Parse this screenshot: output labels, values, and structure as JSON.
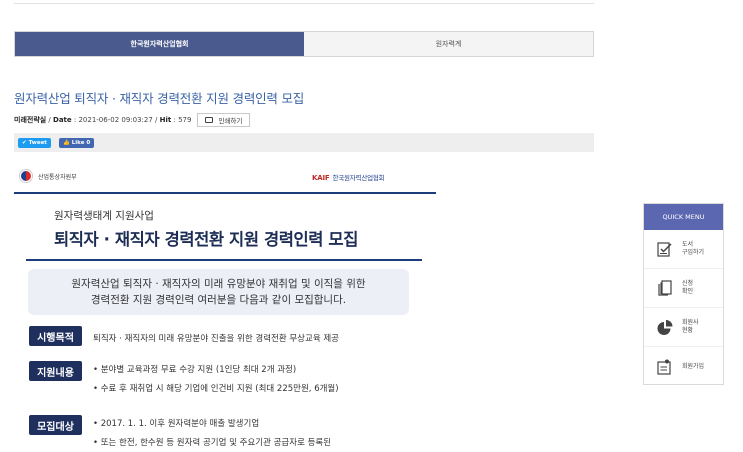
{
  "tabs": [
    {
      "label": "한국원자력산업협회"
    },
    {
      "label": "원자력계"
    }
  ],
  "article": {
    "title": "원자력산업 퇴직자 · 재직자 경력전환 지원 경력인력 모집",
    "author": "미래전략실",
    "date_label": "Date",
    "date": "2021-06-02 09:03:27",
    "hit_label": "Hit",
    "hit": "579",
    "print_label": "인쇄하기"
  },
  "social": {
    "tweet": "Tweet",
    "like": "Like 0"
  },
  "poster": {
    "ministry": "산업통상자원부",
    "kaif_mark": "KAIF",
    "kaif_name": "한국원자력산업협회",
    "subtitle": "원자력생태계 지원사업",
    "headline": "퇴직자 · 재직자 경력전환 지원 경력인력 모집",
    "intro_line1": "원자력산업 퇴직자 · 재직자의 미래 유망분야 재취업 및 이직을 위한",
    "intro_line2": "경력전환 지원 경력인력 여러분을 다음과 같이 모집합니다.",
    "rows": [
      {
        "badge": "시행목적",
        "lines": [
          "퇴직자 · 재직자의 미래 유망분야 진출을 위한 경력전환 무상교육 제공"
        ]
      },
      {
        "badge": "지원내용",
        "lines": [
          "• 분야별 교육과정 무료 수강 지원 (1인당 최대 2개 과정)",
          "• 수료 후 재취업 시 해당 기업에 인건비 지원 (최대 225만원, 6개월)"
        ]
      },
      {
        "badge": "모집대상",
        "lines": [
          "• 2017. 1. 1. 이후 원자력분야 매출 발생기업",
          "• 또는 한전, 한수원 등 원자력 공기업 및 주요기관 공급자로 등록된"
        ]
      }
    ]
  },
  "quick_menu": {
    "title": "QUICK MENU",
    "items": [
      {
        "label_1": "도서",
        "label_2": "구입하기",
        "icon": "book-check-icon"
      },
      {
        "label_1": "신청",
        "label_2": "확인",
        "icon": "document-stack-icon"
      },
      {
        "label_1": "회원사",
        "label_2": "현황",
        "icon": "pie-chart-icon"
      },
      {
        "label_1": "회원가입",
        "label_2": "",
        "icon": "member-register-icon"
      }
    ]
  },
  "colors": {
    "tab_active": "#4a5a8e",
    "title": "#3b63a8",
    "badge": "#1f2f5e",
    "quick_head": "#5b67b0"
  }
}
